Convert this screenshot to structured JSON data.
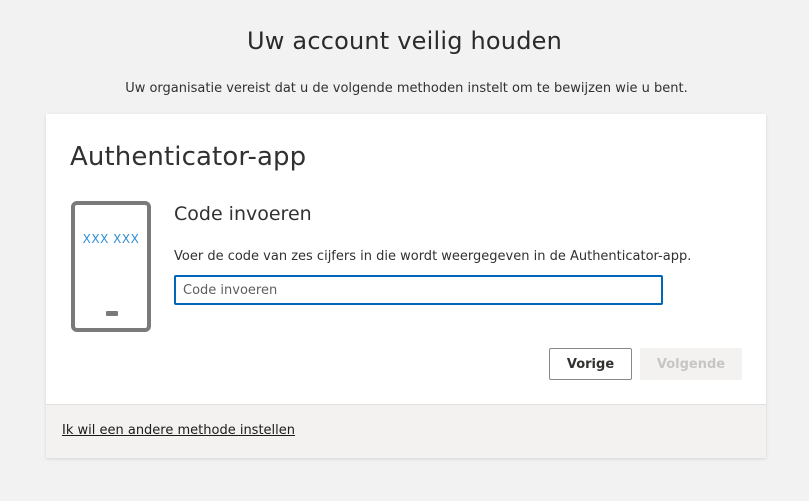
{
  "header": {
    "title": "Uw account veilig houden",
    "subtitle": "Uw organisatie vereist dat u de volgende methoden instelt om te bewijzen wie u bent."
  },
  "card": {
    "title": "Authenticator-app",
    "phone_code": "XXX XXX",
    "step_title": "Code invoeren",
    "step_description": "Voer de code van zes cijfers in die wordt weergegeven in de Authenticator-app.",
    "code_input": {
      "placeholder": "Code invoeren",
      "value": ""
    },
    "buttons": {
      "back_label": "Vorige",
      "next_label": "Volgende"
    },
    "footer_link": "Ik wil een andere methode instellen"
  },
  "colors": {
    "accent": "#0067b8",
    "phone_code": "#2f8fd6",
    "background": "#f2f2f2"
  },
  "icons": {
    "phone": "phone-icon"
  }
}
